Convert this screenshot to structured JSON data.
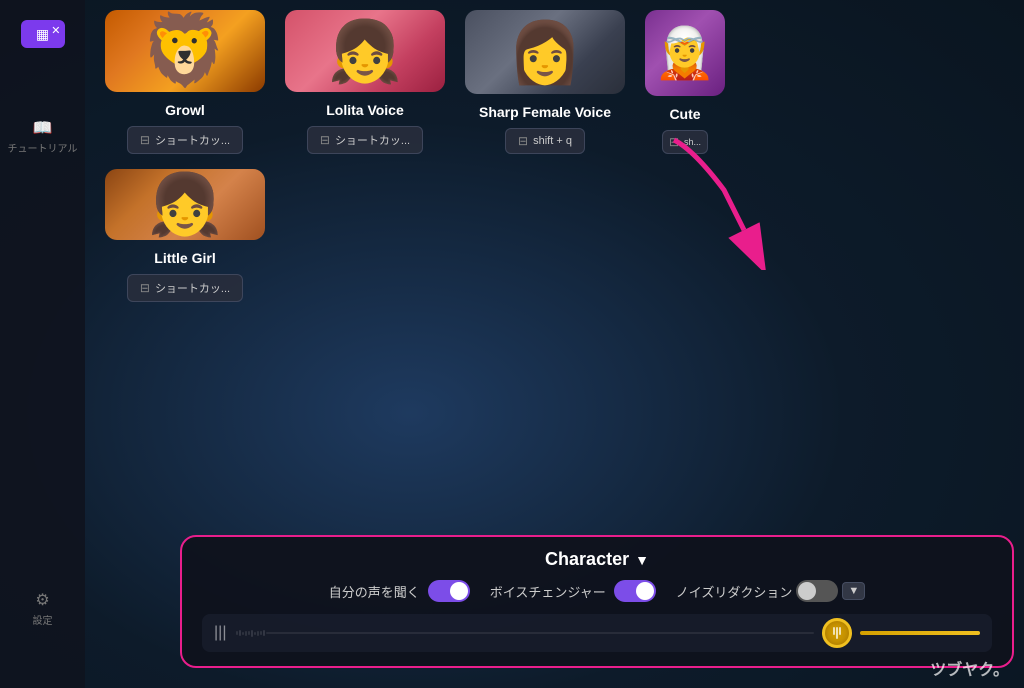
{
  "background": {
    "color": "#0d1b2a"
  },
  "sidebar": {
    "tutorial_icon": "📖",
    "tutorial_label": "チュートリアル",
    "settings_icon": "⚙",
    "settings_label": "設定"
  },
  "voice_cards_row1": [
    {
      "id": "growl",
      "name": "Growl",
      "shortcut_label": "ショートカッ...",
      "shortcut_key": ""
    },
    {
      "id": "lolita",
      "name": "Lolita Voice",
      "shortcut_label": "ショートカッ...",
      "shortcut_key": ""
    },
    {
      "id": "sharp-female",
      "name": "Sharp Female Voice",
      "shortcut_label": "shift + q",
      "shortcut_key": "shift + q"
    },
    {
      "id": "cute",
      "name": "Cute",
      "shortcut_label": "sh...",
      "shortcut_key": ""
    }
  ],
  "voice_cards_row2": [
    {
      "id": "little-girl",
      "name": "Little Girl",
      "shortcut_label": "ショートカッ...",
      "shortcut_key": ""
    }
  ],
  "bottom_panel": {
    "character_label": "Character",
    "dropdown_icon": "▼",
    "controls": [
      {
        "id": "self-listen",
        "label": "自分の声を聞く",
        "toggle_state": "on"
      },
      {
        "id": "voice-changer",
        "label": "ボイスチェンジャー",
        "toggle_state": "on"
      },
      {
        "id": "noise-reduction",
        "label": "ノイズリダクション",
        "toggle_state": "off"
      }
    ]
  },
  "watermark": "ツブヤク。",
  "shortcut_icon": "⊟"
}
